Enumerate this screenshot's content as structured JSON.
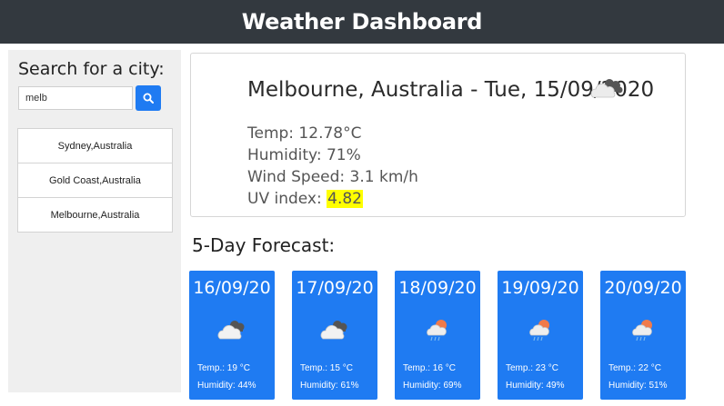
{
  "header": {
    "title": "Weather Dashboard"
  },
  "sidebar": {
    "search_title": "Search for a city:",
    "search_value": "melb",
    "search_button_icon": "search-icon",
    "history": [
      "Sydney,Australia",
      "Gold Coast,Australia",
      "Melbourne,Australia"
    ]
  },
  "current": {
    "title": "Melbourne, Australia - Tue, 15/09/2020",
    "icon": "cloudy-icon",
    "temp": "Temp: 12.78°C",
    "humidity": "Humidity: 71%",
    "wind": "Wind Speed: 3.1 km/h",
    "uv_label": "UV index: ",
    "uv_value": "4.82",
    "uv_color": "#ffff00"
  },
  "forecast": {
    "title": "5-Day Forecast:",
    "card_color": "#1f7bf2",
    "days": [
      {
        "date": "16/09/20",
        "icon": "cloudy-icon",
        "temp": "Temp.: 19 °C",
        "humidity": "Humidity: 44%"
      },
      {
        "date": "17/09/20",
        "icon": "cloudy-icon",
        "temp": "Temp.: 15 °C",
        "humidity": "Humidity: 61%"
      },
      {
        "date": "18/09/20",
        "icon": "sun-rain-icon",
        "temp": "Temp.: 16 °C",
        "humidity": "Humidity: 69%"
      },
      {
        "date": "19/09/20",
        "icon": "sun-rain-icon",
        "temp": "Temp.: 23 °C",
        "humidity": "Humidity: 49%"
      },
      {
        "date": "20/09/20",
        "icon": "sun-rain-icon",
        "temp": "Temp.: 22 °C",
        "humidity": "Humidity: 51%"
      }
    ]
  }
}
